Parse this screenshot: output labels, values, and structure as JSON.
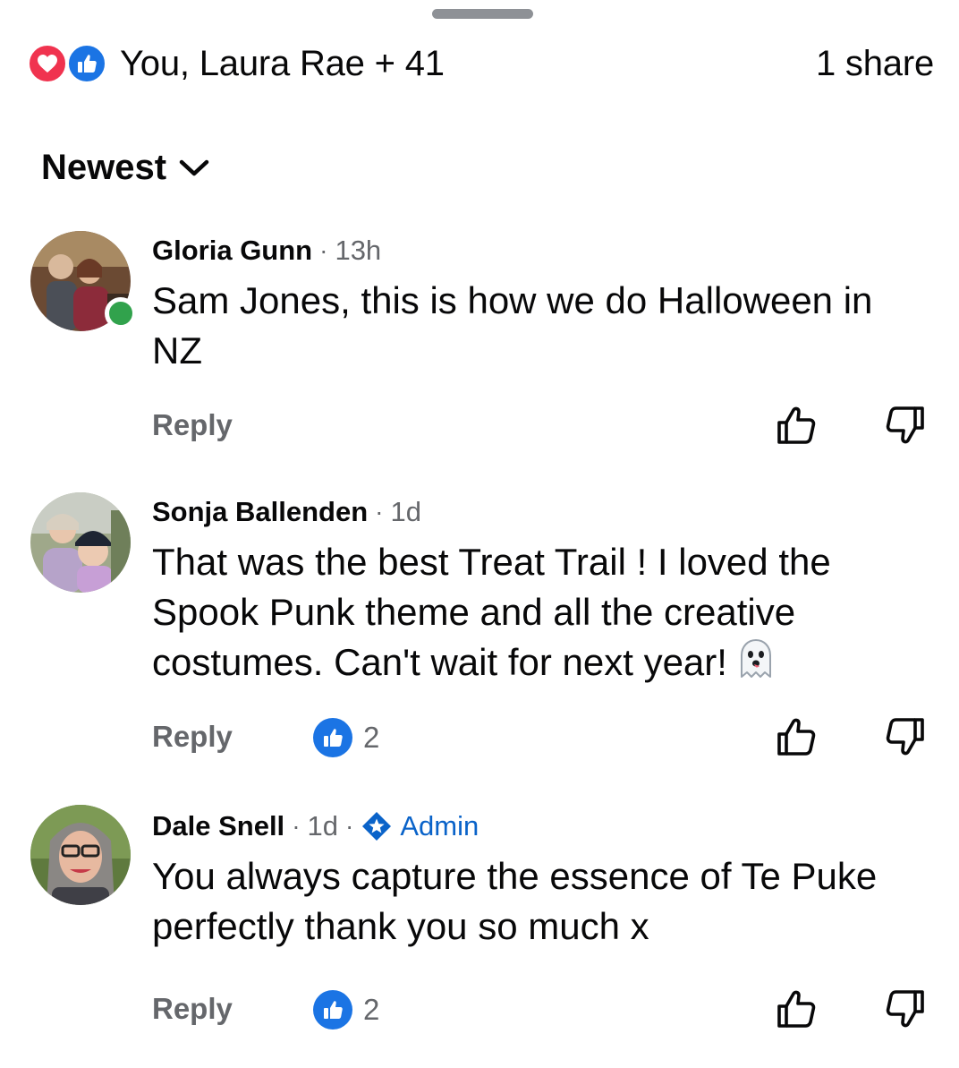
{
  "summary": {
    "reactors_text": "You, Laura Rae + 41",
    "share_text": "1 share"
  },
  "sort": {
    "label": "Newest"
  },
  "comments": [
    {
      "author": "Gloria Gunn",
      "time": "13h",
      "text": "Sam Jones, this is how we do Halloween in NZ",
      "online": true,
      "reply_label": "Reply"
    },
    {
      "author": "Sonja Ballenden",
      "time": "1d",
      "text": "That was the best Treat Trail ! I loved the Spook Punk theme and all the creative costumes. Can't wait for next year!",
      "emoji": "ghost-emoji",
      "like_count": "2",
      "reply_label": "Reply"
    },
    {
      "author": "Dale Snell",
      "time": "1d",
      "badge": "Admin",
      "text": "You always capture the essence of Te Puke perfectly thank you so much x",
      "like_count": "2",
      "reply_label": "Reply"
    }
  ],
  "separator": "·",
  "colors": {
    "like_blue": "#1b74e4",
    "love_red": "#f0334f",
    "online_green": "#31a24c",
    "secondary_text": "#65676b",
    "admin_blue": "#0a63c9"
  },
  "icons": {
    "love": "heart-icon",
    "like": "thumbs-up-icon",
    "sort": "chevron-down-icon",
    "upvote": "thumbs-up-outline-icon",
    "downvote": "thumbs-down-outline-icon",
    "admin": "admin-star-badge-icon"
  }
}
